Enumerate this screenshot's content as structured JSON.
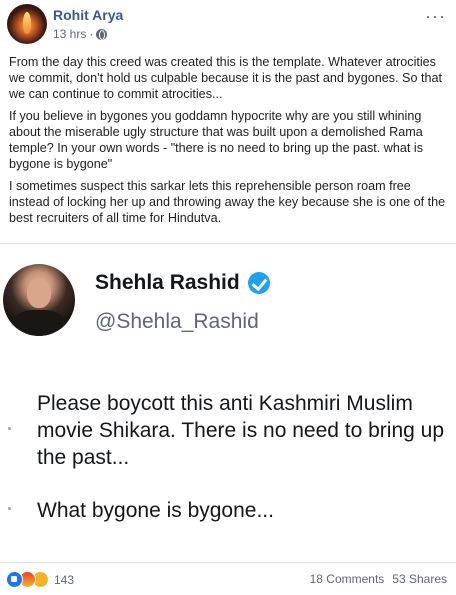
{
  "post": {
    "author": "Rohit Arya",
    "time": "13 hrs",
    "time_separator": "·",
    "more_label": "···",
    "paragraphs": [
      "From the day this creed was created this is the template. Whatever atrocities we commit, don't hold us culpable because it is the past and bygones. So that we can continue to commit atrocities...",
      "If you believe in bygones you goddamn hypocrite why are you still whining about the miserable ugly structure that was built upon a demolished Rama temple? In your own words - \"there is no need to bring up the past. what is bygone is bygone\"",
      "I sometimes suspect this sarkar lets this reprehensible person roam free instead of locking her up and throwing away the key because she is one of the best recruiters of all time for Hindutva."
    ]
  },
  "tweet": {
    "display_name": "Shehla Rashid",
    "handle": "@Shehla_Rashid",
    "line1": "Please boycott this anti Kashmiri Muslim movie Shikara. There is no need to bring up the past...",
    "line2": "What bygone is bygone..."
  },
  "footer": {
    "reaction_count": "143",
    "comments": "18 Comments",
    "shares": "53 Shares",
    "reactions": [
      "like-icon",
      "angry-icon",
      "sad-icon"
    ]
  }
}
